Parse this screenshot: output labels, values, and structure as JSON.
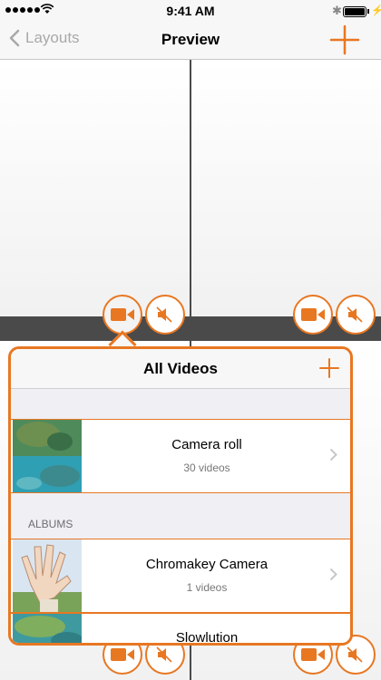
{
  "status_bar": {
    "time": "9:41 AM",
    "battery_level": 1.0
  },
  "nav": {
    "back_label": "Layouts",
    "title": "Preview"
  },
  "colors": {
    "accent": "#e87722",
    "background": "#4a4a4a"
  },
  "cell_controls": [
    {
      "camera_icon": "video-camera-icon",
      "mute_icon": "speaker-muted-icon"
    }
  ],
  "popover": {
    "title": "All Videos",
    "top_rows": [
      {
        "title": "Camera roll",
        "subtitle": "30 videos"
      }
    ],
    "albums_header": "ALBUMS",
    "album_rows": [
      {
        "title": "Chromakey Camera",
        "subtitle": "1 videos"
      },
      {
        "title": "Slowlution",
        "subtitle": ""
      }
    ]
  }
}
